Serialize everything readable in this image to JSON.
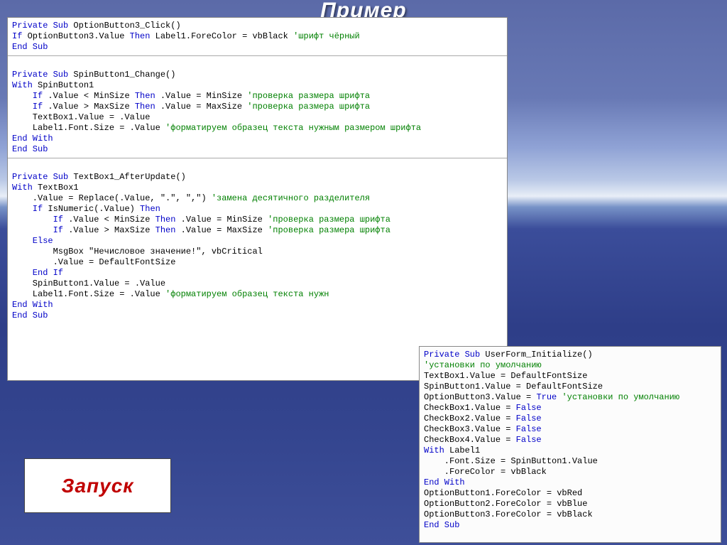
{
  "title": "Пример",
  "launch_label": "Запуск",
  "left_panel": {
    "block1": {
      "l1a": "Private Sub",
      "l1b": " OptionButton3_Click()",
      "l2a": "If",
      "l2b": " OptionButton3.Value ",
      "l2c": "Then",
      "l2d": " Label1.ForeColor = vbBlack ",
      "l2e": "'шрифт чёрный",
      "l3a": "End Sub"
    },
    "block2": {
      "l1a": "Private Sub",
      "l1b": " SpinButton1_Change()",
      "l2a": "With",
      "l2b": " SpinButton1",
      "l3a": "    If",
      "l3b": " .Value < MinSize ",
      "l3c": "Then",
      "l3d": " .Value = MinSize ",
      "l3e": "'проверка размера шрифта",
      "l4a": "    If",
      "l4b": " .Value > MaxSize ",
      "l4c": "Then",
      "l4d": " .Value = MaxSize ",
      "l4e": "'проверка размера шрифта",
      "l5": "    TextBox1.Value = .Value",
      "l6a": "    Label1.Font.Size = .Value ",
      "l6b": "'форматируем образец текста нужным размером шрифта",
      "l7a": "End With",
      "l8a": "End Sub"
    },
    "block3": {
      "l1a": "Private Sub",
      "l1b": " TextBox1_AfterUpdate()",
      "l2a": "With",
      "l2b": " TextBox1",
      "l3a": "    .Value = Replace(.Value, \".\", \",\") ",
      "l3b": "'замена десятичного разделителя",
      "l4a": "    If",
      "l4b": " IsNumeric(.Value) ",
      "l4c": "Then",
      "l5a": "        If",
      "l5b": " .Value < MinSize ",
      "l5c": "Then",
      "l5d": " .Value = MinSize ",
      "l5e": "'проверка размера шрифта",
      "l6a": "        If",
      "l6b": " .Value > MaxSize ",
      "l6c": "Then",
      "l6d": " .Value = MaxSize ",
      "l6e": "'проверка размера шрифта",
      "l7a": "    Else",
      "l8": "        MsgBox \"Нечисловое значение!\", vbCritical",
      "l9": "        .Value = DefaultFontSize",
      "l10a": "    End If",
      "l11": "    SpinButton1.Value = .Value",
      "l12a": "    Label1.Font.Size = .Value ",
      "l12b": "'форматируем образец текста нужн",
      "l13a": "End With",
      "l14a": "End Sub"
    }
  },
  "right_panel": {
    "l1a": "Private Sub",
    "l1b": " UserForm_Initialize()",
    "l2": "'установки по умолчанию",
    "l3": "TextBox1.Value = DefaultFontSize",
    "l4": "SpinButton1.Value = DefaultFontSize",
    "l5a": "OptionButton3.Value = ",
    "l5b": "True ",
    "l5c": "'установки по умолчанию",
    "l6a": "CheckBox1.Value = ",
    "l6b": "False",
    "l7a": "CheckBox2.Value = ",
    "l7b": "False",
    "l8a": "CheckBox3.Value = ",
    "l8b": "False",
    "l9a": "CheckBox4.Value = ",
    "l9b": "False",
    "l10a": "With",
    "l10b": " Label1",
    "l11": "    .Font.Size = SpinButton1.Value",
    "l12": "    .ForeColor = vbBlack",
    "l13a": "End With",
    "l14": "OptionButton1.ForeColor = vbRed",
    "l15": "OptionButton2.ForeColor = vbBlue",
    "l16": "OptionButton3.ForeColor = vbBlack",
    "l17a": "End Sub"
  }
}
